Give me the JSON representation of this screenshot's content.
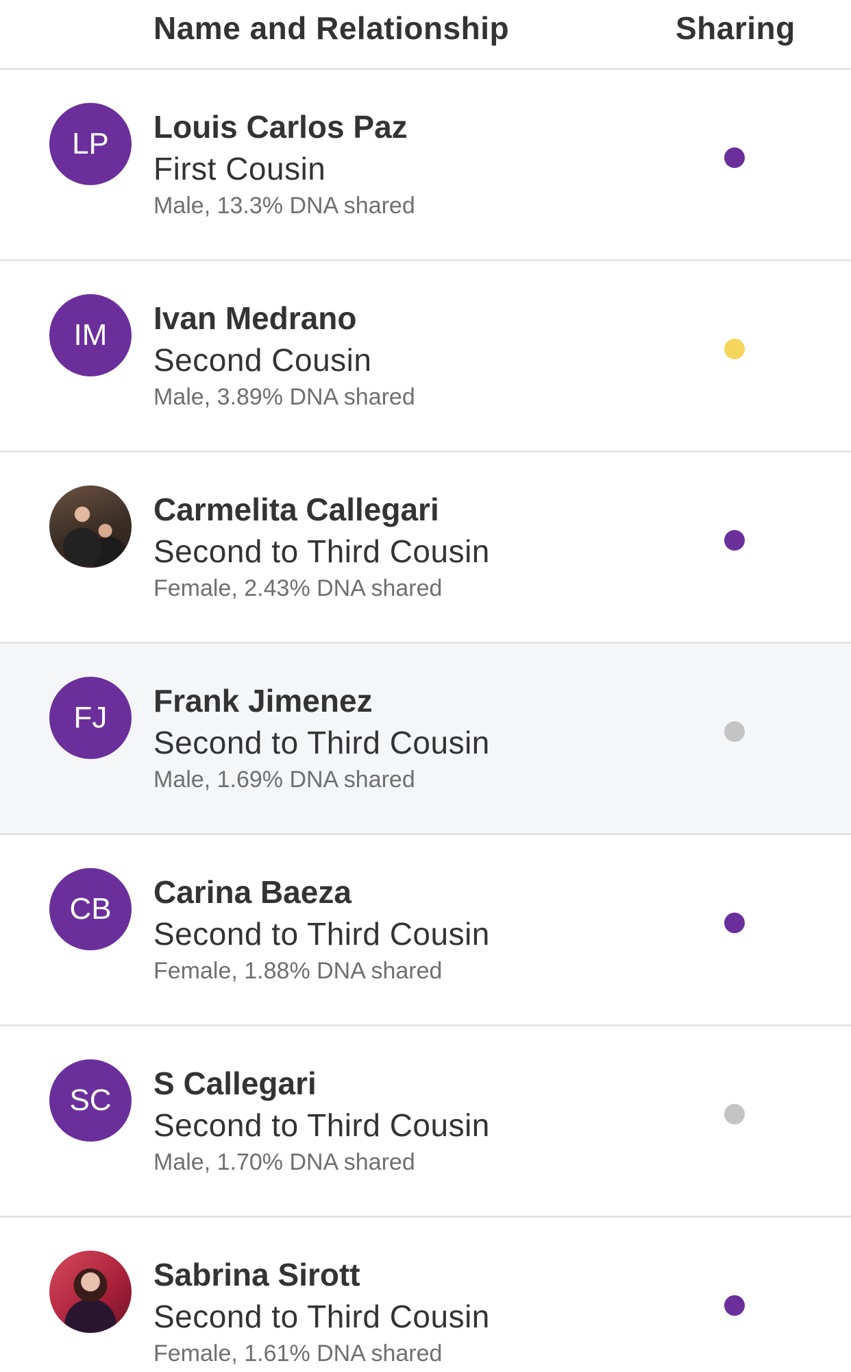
{
  "header": {
    "name_col": "Name and Relationship",
    "sharing_col": "Sharing"
  },
  "rows": [
    {
      "initials": "LP",
      "name": "Louis Carlos Paz",
      "relationship": "First Cousin",
      "details": "Male, 13.3% DNA shared",
      "sharing_status": "sharing",
      "dot_color": "#6b2f9c",
      "avatar_type": "initials"
    },
    {
      "initials": "IM",
      "name": "Ivan Medrano",
      "relationship": "Second Cousin",
      "details": "Male, 3.89% DNA shared",
      "sharing_status": "pending",
      "dot_color": "#f5d55c",
      "avatar_type": "initials"
    },
    {
      "initials": "",
      "name": "Carmelita Callegari",
      "relationship": "Second to Third Cousin",
      "details": "Female, 2.43% DNA shared",
      "sharing_status": "sharing",
      "dot_color": "#6b2f9c",
      "avatar_type": "photo"
    },
    {
      "initials": "FJ",
      "name": "Frank Jimenez",
      "relationship": "Second to Third Cousin",
      "details": "Male, 1.69% DNA shared",
      "sharing_status": "not-sharing",
      "dot_color": "#c4c4c4",
      "avatar_type": "initials"
    },
    {
      "initials": "CB",
      "name": "Carina Baeza",
      "relationship": "Second to Third Cousin",
      "details": "Female, 1.88% DNA shared",
      "sharing_status": "sharing",
      "dot_color": "#6b2f9c",
      "avatar_type": "initials"
    },
    {
      "initials": "SC",
      "name": "S Callegari",
      "relationship": "Second to Third Cousin",
      "details": "Male, 1.70% DNA shared",
      "sharing_status": "not-sharing",
      "dot_color": "#c4c4c4",
      "avatar_type": "initials"
    },
    {
      "initials": "",
      "name": "Sabrina Sirott",
      "relationship": "Second to Third Cousin",
      "details": "Female, 1.61% DNA shared",
      "sharing_status": "sharing",
      "dot_color": "#6b2f9c",
      "avatar_type": "photo"
    }
  ],
  "colors": {
    "accent_purple": "#6b2f9c",
    "pending_yellow": "#f5d55c",
    "inactive_gray": "#c4c4c4",
    "highlight_row_bg": "#f5f6f8"
  }
}
